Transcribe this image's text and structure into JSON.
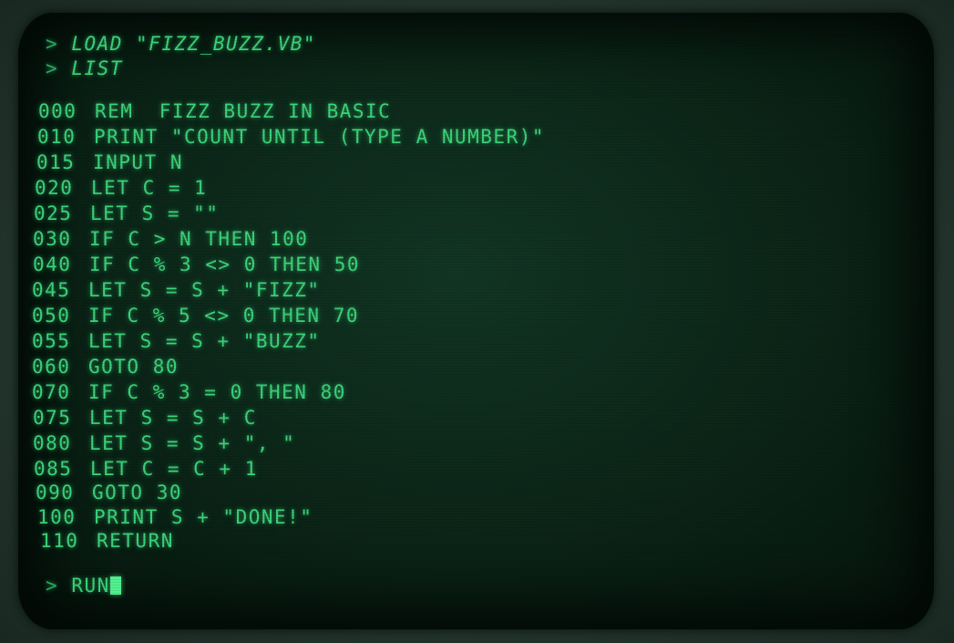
{
  "terminal": {
    "prompt_symbol": ">",
    "commands": [
      "LOAD \"FIZZ_BUZZ.VB\"",
      "LIST"
    ],
    "program": [
      {
        "num": "000",
        "code": "REM  FIZZ BUZZ IN BASIC"
      },
      {
        "num": "010",
        "code": "PRINT \"COUNT UNTIL (TYPE A NUMBER)\""
      },
      {
        "num": "015",
        "code": "INPUT N"
      },
      {
        "num": "020",
        "code": "LET C = 1"
      },
      {
        "num": "025",
        "code": "LET S = \"\""
      },
      {
        "num": "030",
        "code": "IF C > N THEN 100"
      },
      {
        "num": "040",
        "code": "IF C % 3 <> 0 THEN 50"
      },
      {
        "num": "045",
        "code": "LET S = S + \"FIZZ\""
      },
      {
        "num": "050",
        "code": "IF C % 5 <> 0 THEN 70"
      },
      {
        "num": "055",
        "code": "LET S = S + \"BUZZ\""
      },
      {
        "num": "060",
        "code": "GOTO 80"
      },
      {
        "num": "070",
        "code": "IF C % 3 = 0 THEN 80"
      },
      {
        "num": "075",
        "code": "LET S = S + C"
      },
      {
        "num": "080",
        "code": "LET S = S + \", \""
      },
      {
        "num": "085",
        "code": "LET C = C + 1"
      },
      {
        "num": "090",
        "code": "GOTO 30"
      },
      {
        "num": "100",
        "code": "PRINT S + \"DONE!\""
      },
      {
        "num": "110",
        "code": "RETURN"
      }
    ],
    "input_line": "RUN"
  },
  "colors": {
    "phosphor": "#3cd37a",
    "screen": "#0c2719",
    "bezel": "#2f453b"
  }
}
